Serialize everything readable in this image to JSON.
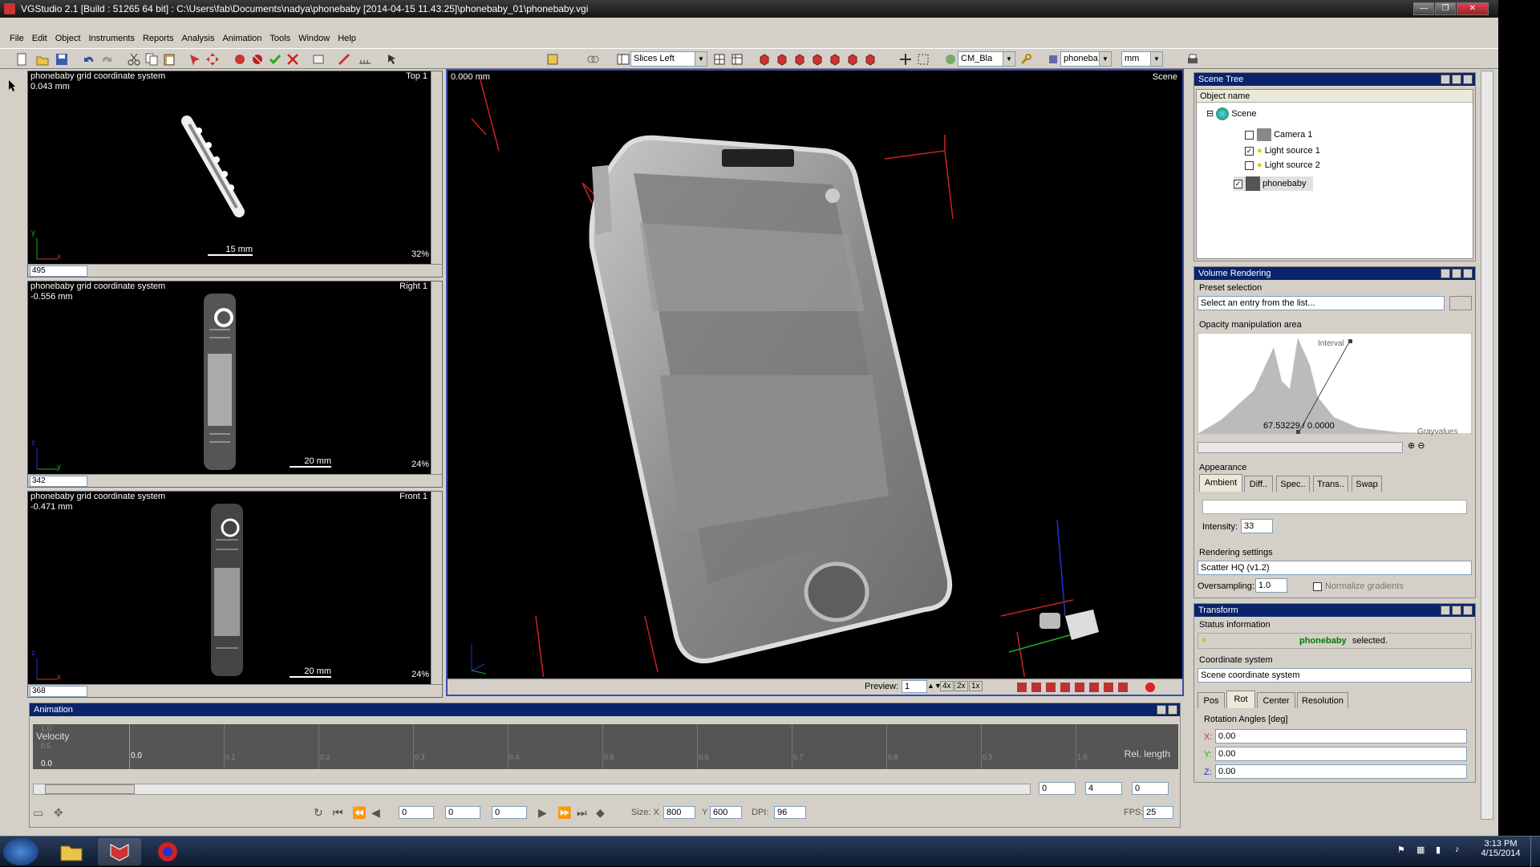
{
  "window": {
    "title": "VGStudio 2.1  [Build : 51265   64 bit] : C:\\Users\\fab\\Documents\\nadya\\phonebaby [2014-04-15 11.43.25]\\phonebaby_01\\phonebaby.vgi",
    "controls": [
      "—",
      "❐",
      "✕"
    ]
  },
  "menu": [
    "File",
    "Edit",
    "Object",
    "Instruments",
    "Reports",
    "Analysis",
    "Animation",
    "Tools",
    "Window",
    "Help"
  ],
  "toolbar": {
    "layout_dropdown": "Slices Left",
    "colormap_dropdown": "CM_Bla",
    "object_dropdown": "phoneba",
    "unit_dropdown": "mm"
  },
  "views": [
    {
      "coord": "phonebaby grid coordinate system",
      "value": "0.043 mm",
      "tag": "Top 1",
      "scale": "15 mm",
      "zoom": "32%",
      "slice": "495",
      "axis_v": "y",
      "axis_h": "x"
    },
    {
      "coord": "phonebaby grid coordinate system",
      "value": "-0.556 mm",
      "tag": "Right 1",
      "scale": "20 mm",
      "zoom": "24%",
      "slice": "342",
      "axis_v": "z",
      "axis_h": "y"
    },
    {
      "coord": "phonebaby grid coordinate system",
      "value": "-0.471 mm",
      "tag": "Front 1",
      "scale": "20 mm",
      "zoom": "24%",
      "slice": "368",
      "axis_v": "z",
      "axis_h": "x"
    }
  ],
  "view3d": {
    "value": "0.000 mm",
    "tag": "Scene",
    "preview_label": "Preview:",
    "preview_value": "1",
    "zoom_buttons": [
      "4x",
      "2x",
      "1x"
    ]
  },
  "scene_tree": {
    "title": "Scene Tree",
    "column": "Object name",
    "items": [
      {
        "label": "Scene",
        "checked": null
      },
      {
        "label": "Camera 1",
        "checked": false
      },
      {
        "label": "Light source 1",
        "checked": true
      },
      {
        "label": "Light source 2",
        "checked": false
      },
      {
        "label": "phonebaby",
        "checked": true
      }
    ]
  },
  "volume_rendering": {
    "title": "Volume Rendering",
    "preset_label": "Preset selection",
    "preset_placeholder": "Select an entry from the list...",
    "opacity_label": "Opacity manipulation area",
    "interval_label": "Interval",
    "point_value": "67.53229 / 0.0000",
    "gray_label": "Grayvalues",
    "appearance_label": "Appearance",
    "tabs": [
      "Ambient",
      "Diff..",
      "Spec..",
      "Trans..",
      "Swap"
    ],
    "intensity_label": "Intensity:",
    "intensity_value": "33",
    "rendering_label": "Rendering settings",
    "rendering_value": "Scatter HQ (v1.2)",
    "oversampling_label": "Oversampling:",
    "oversampling_value": "1.0",
    "normalize_label": "Normalize gradients"
  },
  "transform": {
    "title": "Transform",
    "status_label": "Status information",
    "selected_object": "phonebaby",
    "selected_suffix": " selected.",
    "coord_label": "Coordinate system",
    "coord_value": "Scene coordinate system",
    "tabs": [
      "Pos",
      "Rot",
      "Center",
      "Resolution"
    ],
    "rotation_label": "Rotation Angles [deg]",
    "x_label": "X:",
    "x_value": "0.00",
    "y_label": "Y:",
    "y_value": "0.00",
    "z_label": "Z:",
    "z_value": "0.00"
  },
  "animation": {
    "title": "Animation",
    "velocity_label": "Velocity",
    "y_ticks": [
      "1.0",
      "0.5",
      "0.0"
    ],
    "zero_label": "0.0",
    "x_ticks": [
      "0.1",
      "0.2",
      "0.3",
      "0.4",
      "0.5",
      "0.6",
      "0.7",
      "0.8",
      "0.9",
      "1.0"
    ],
    "rel_length_label": "Rel. length",
    "range_fields": [
      "0",
      "4",
      "0"
    ],
    "frame_fields": [
      "0",
      "0",
      "0"
    ],
    "size_label": "Size: X",
    "size_x": "800",
    "size_y_label": "Y",
    "size_y": "600",
    "dpi_label": "DPI:",
    "dpi_value": "96",
    "fps_label": "FPS:",
    "fps_value": "25"
  },
  "taskbar": {
    "time": "3:13 PM",
    "date": "4/15/2014"
  },
  "colors": {
    "accent": "#0a246a",
    "selected_text": "#007700",
    "axis_red": "#cc2222",
    "axis_blue": "#2233cc",
    "axis_green": "#22aa22"
  }
}
